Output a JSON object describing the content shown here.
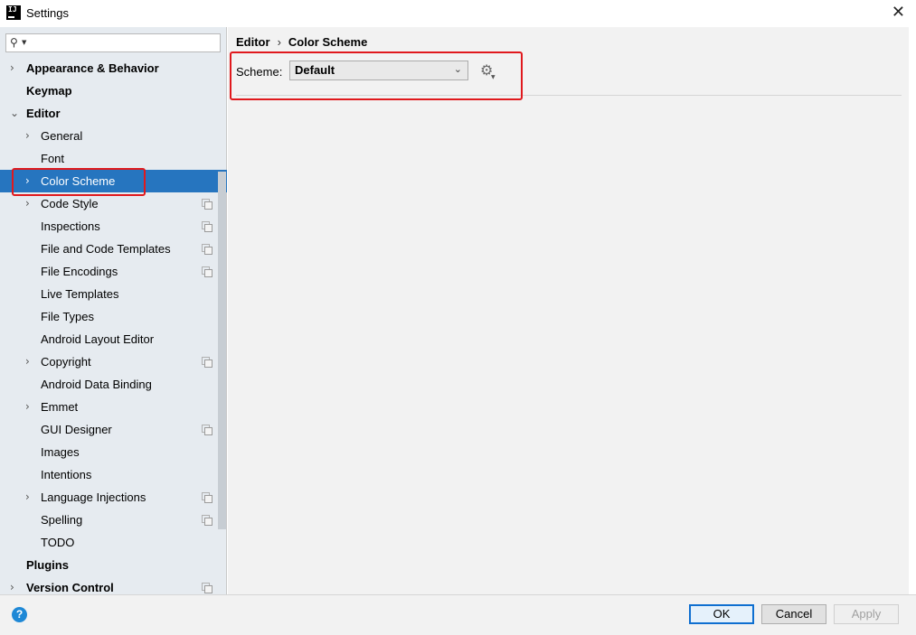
{
  "window": {
    "title": "Settings",
    "icon_text": "IJ"
  },
  "search": {
    "placeholder": "",
    "value": ""
  },
  "tree": [
    {
      "label": "Appearance & Behavior",
      "level": 0,
      "arrow": "right",
      "proj": false,
      "selected": false
    },
    {
      "label": "Keymap",
      "level": 0,
      "arrow": "none",
      "proj": false,
      "selected": false
    },
    {
      "label": "Editor",
      "level": 0,
      "arrow": "down",
      "proj": false,
      "selected": false
    },
    {
      "label": "General",
      "level": 1,
      "arrow": "right",
      "proj": false,
      "selected": false
    },
    {
      "label": "Font",
      "level": 1,
      "arrow": "none",
      "proj": false,
      "selected": false
    },
    {
      "label": "Color Scheme",
      "level": 1,
      "arrow": "right",
      "proj": false,
      "selected": true
    },
    {
      "label": "Code Style",
      "level": 1,
      "arrow": "right",
      "proj": true,
      "selected": false
    },
    {
      "label": "Inspections",
      "level": 1,
      "arrow": "none",
      "proj": true,
      "selected": false
    },
    {
      "label": "File and Code Templates",
      "level": 1,
      "arrow": "none",
      "proj": true,
      "selected": false
    },
    {
      "label": "File Encodings",
      "level": 1,
      "arrow": "none",
      "proj": true,
      "selected": false
    },
    {
      "label": "Live Templates",
      "level": 1,
      "arrow": "none",
      "proj": false,
      "selected": false
    },
    {
      "label": "File Types",
      "level": 1,
      "arrow": "none",
      "proj": false,
      "selected": false
    },
    {
      "label": "Android Layout Editor",
      "level": 1,
      "arrow": "none",
      "proj": false,
      "selected": false
    },
    {
      "label": "Copyright",
      "level": 1,
      "arrow": "right",
      "proj": true,
      "selected": false
    },
    {
      "label": "Android Data Binding",
      "level": 1,
      "arrow": "none",
      "proj": false,
      "selected": false
    },
    {
      "label": "Emmet",
      "level": 1,
      "arrow": "right",
      "proj": false,
      "selected": false
    },
    {
      "label": "GUI Designer",
      "level": 1,
      "arrow": "none",
      "proj": true,
      "selected": false
    },
    {
      "label": "Images",
      "level": 1,
      "arrow": "none",
      "proj": false,
      "selected": false
    },
    {
      "label": "Intentions",
      "level": 1,
      "arrow": "none",
      "proj": false,
      "selected": false
    },
    {
      "label": "Language Injections",
      "level": 1,
      "arrow": "right",
      "proj": true,
      "selected": false
    },
    {
      "label": "Spelling",
      "level": 1,
      "arrow": "none",
      "proj": true,
      "selected": false
    },
    {
      "label": "TODO",
      "level": 1,
      "arrow": "none",
      "proj": false,
      "selected": false
    },
    {
      "label": "Plugins",
      "level": 0,
      "arrow": "none",
      "proj": false,
      "selected": false
    },
    {
      "label": "Version Control",
      "level": 0,
      "arrow": "right",
      "proj": true,
      "selected": false
    }
  ],
  "breadcrumb": {
    "parent": "Editor",
    "separator": "›",
    "current": "Color Scheme"
  },
  "scheme": {
    "label": "Scheme:",
    "selected": "Default"
  },
  "buttons": {
    "ok": "OK",
    "cancel": "Cancel",
    "apply": "Apply",
    "help": "?"
  },
  "colors": {
    "selection": "#2675bf",
    "highlight": "#e0191d",
    "help": "#1e88d6"
  }
}
